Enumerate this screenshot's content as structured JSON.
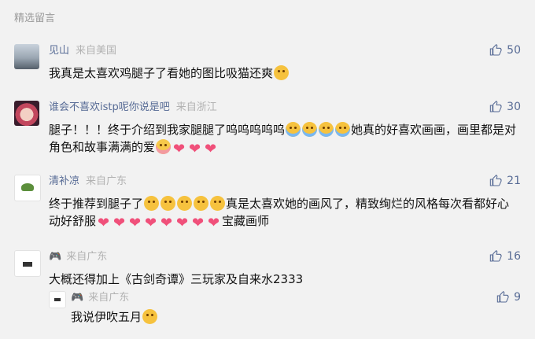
{
  "section_title": "精选留言",
  "comments": [
    {
      "name": "见山",
      "location": "来自美国",
      "likes": "50",
      "text_parts": [
        "我真是太喜欢鸡腿子了看她的图比吸猫还爽"
      ],
      "emojis": 1,
      "hearts": 0
    },
    {
      "name": "谁会不喜欢istp呢你说是吧",
      "location": "来自浙江",
      "likes": "30",
      "text_parts": [
        "腿子！！！终于介绍到我家腿腿了呜呜呜呜呜",
        "她真的好喜欢画画，画里都是对角色和故事满满的爱"
      ],
      "emojis": 4,
      "hearts": 3
    },
    {
      "name": "清补凉",
      "location": "来自广东",
      "likes": "21",
      "text_parts": [
        "终于推荐到腿子了",
        "真是太喜欢她的画风了，精致绚烂的风格每次看都好心动好舒服",
        "宝藏画师"
      ],
      "emojis": 5,
      "hearts": 8
    },
    {
      "name": "",
      "location": "来自广东",
      "likes": "16",
      "text_parts": [
        "大概还得加上《古剑奇谭》三玩家及自来水2333"
      ],
      "emojis": 0,
      "hearts": 0
    }
  ],
  "reply": {
    "name": "",
    "location": "来自广东",
    "likes": "9",
    "text": "我说伊吹五月"
  },
  "colors": {
    "name": "#576b95",
    "location": "#b2b2b2",
    "background": "#f2f2f2"
  },
  "icons": [
    "thumb-up-icon",
    "gamepad-icon"
  ]
}
